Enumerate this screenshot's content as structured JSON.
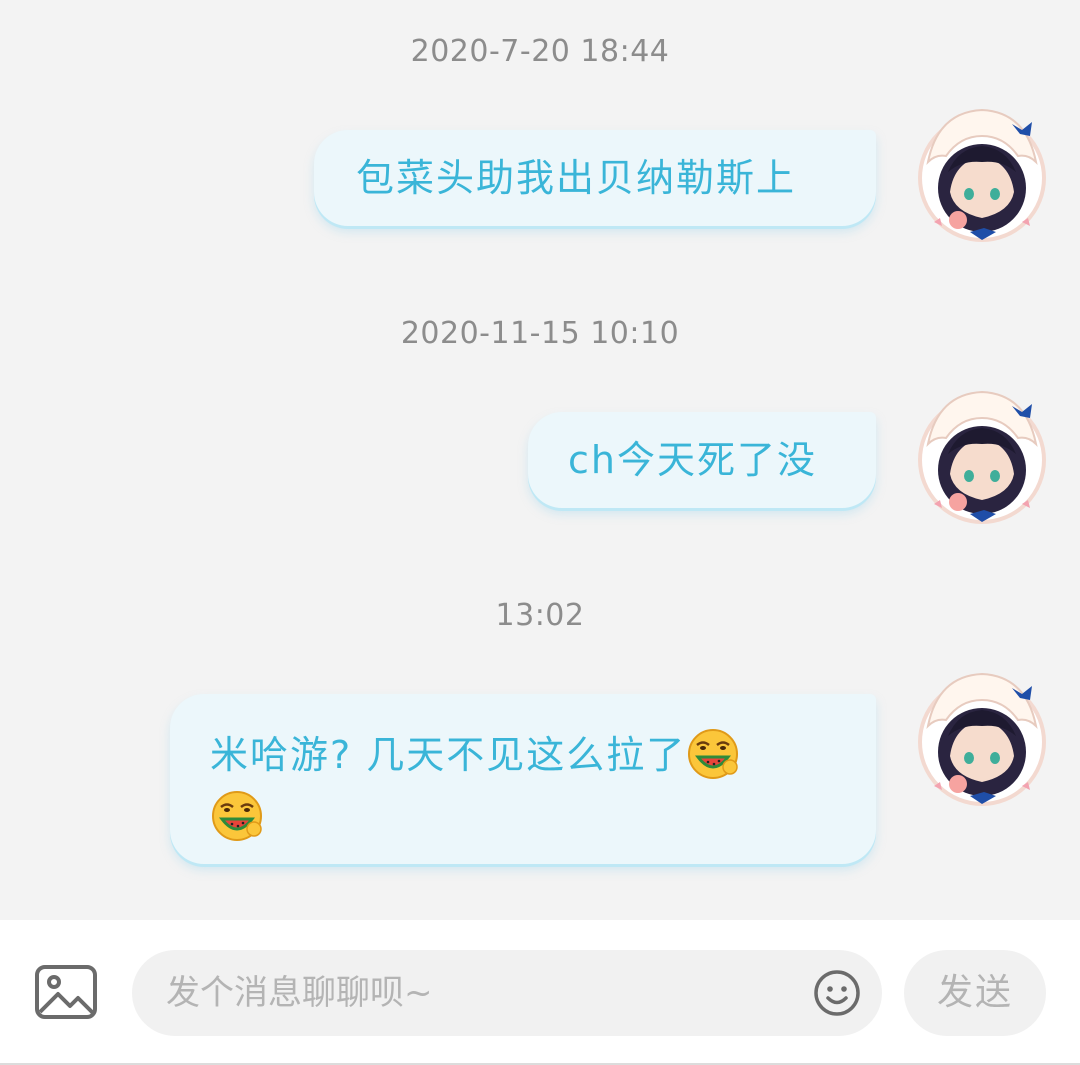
{
  "messages": [
    {
      "timestamp": "2020-7-20 18:44",
      "text": "包菜头助我出贝纳勒斯上"
    },
    {
      "timestamp": "2020-11-15 10:10",
      "text": "ch今天死了没"
    },
    {
      "timestamp": "13:02",
      "text_line1": "米哈游? 几天不见这么拉了",
      "emoji": "watermelon-eating-face-emoji"
    }
  ],
  "input": {
    "placeholder": "发个消息聊聊呗~",
    "value": ""
  },
  "send_label": "发送",
  "icons": {
    "image": "image-icon",
    "emoji": "smiley-icon"
  },
  "colors": {
    "bubble_bg": "#ecf7fb",
    "bubble_text": "#3ab5d8",
    "timestamp_text": "#8c8c8c",
    "background": "#f3f3f3"
  }
}
